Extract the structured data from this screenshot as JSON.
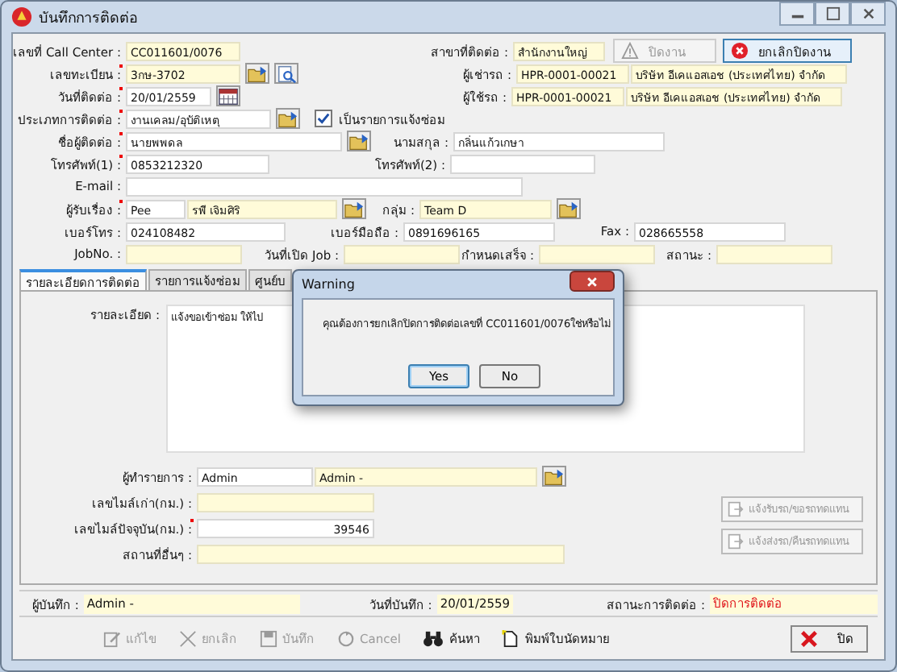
{
  "window": {
    "title": "บันทึกการติดต่อ"
  },
  "header_buttons": [
    {
      "label": "ปิดงาน",
      "kind": "warning",
      "disabled": true
    },
    {
      "label": "ยกเลิกปิดงาน",
      "kind": "cancel",
      "disabled": false
    }
  ],
  "rows": [
    {
      "groups": [
        {
          "kind": "field",
          "label": "เลขที่ Call Center :",
          "required": false,
          "inputs": [
            {
              "value": "CC011601/0076",
              "readonly": true
            }
          ]
        },
        {
          "kind": "field",
          "label": "สาขาที่ติดต่อ :",
          "required": false,
          "inputs": [
            {
              "value": "สำนักงานใหญ่",
              "readonly": true
            }
          ]
        }
      ]
    },
    {
      "groups": [
        {
          "kind": "field",
          "label": "เลขทะเบียน :",
          "required": true,
          "inputs": [
            {
              "value": "3กษ-3702",
              "readonly": true
            }
          ],
          "lookup": true,
          "preview": true
        },
        {
          "kind": "field",
          "label": "ผู้เช่ารถ :",
          "required": false,
          "inputs": [
            {
              "value": "HPR-0001-00021",
              "readonly": true
            },
            {
              "value": "บริษัท อีเคแอสเอช (ประเทศไทย) จำกัด",
              "readonly": true
            }
          ]
        }
      ]
    },
    {
      "groups": [
        {
          "kind": "field",
          "label": "วันที่ติดต่อ :",
          "required": true,
          "inputs": [
            {
              "value": "20/01/2559",
              "readonly": false
            }
          ],
          "calendar": true
        },
        {
          "kind": "field",
          "label": "ผู้ใช้รถ :",
          "required": false,
          "inputs": [
            {
              "value": "HPR-0001-00021",
              "readonly": true
            },
            {
              "value": "บริษัท อีเคแอสเอช (ประเทศไทย) จำกัด",
              "readonly": true
            }
          ]
        }
      ]
    },
    {
      "groups": [
        {
          "kind": "field",
          "label": "ประเภทการติดต่อ :",
          "required": true,
          "inputs": [
            {
              "value": "งานเคลม/อุบัติเหตุ",
              "readonly": false
            }
          ],
          "lookup": true
        },
        {
          "kind": "checkbox",
          "label": "เป็นรายการแจ้งซ่อม",
          "checked": true
        }
      ]
    },
    {
      "groups": [
        {
          "kind": "field",
          "label": "ชื่อผู้ติดต่อ :",
          "required": true,
          "inputs": [
            {
              "value": "นายพพดล",
              "readonly": false
            }
          ],
          "lookup": true
        },
        {
          "kind": "field",
          "label": "นามสกุล :",
          "required": false,
          "inputs": [
            {
              "value": "กลิ่นแก้วเกษา",
              "readonly": false
            }
          ]
        }
      ]
    },
    {
      "groups": [
        {
          "kind": "field",
          "label": "โทรศัพท์(1) :",
          "required": true,
          "inputs": [
            {
              "value": "0853212320",
              "readonly": false
            }
          ]
        },
        {
          "kind": "field",
          "label": "โทรศัพท์(2) :",
          "required": false,
          "inputs": [
            {
              "readonly": false
            }
          ]
        }
      ]
    },
    {
      "groups": [
        {
          "kind": "field",
          "label": "E-mail :",
          "required": false,
          "inputs": [
            {
              "readonly": false
            }
          ]
        }
      ]
    },
    {
      "groups": [
        {
          "kind": "field",
          "label": "ผู้รับเรื่อง :",
          "required": true,
          "inputs": [
            {
              "value": "Pee",
              "readonly": false
            },
            {
              "value": "รพี เจิมศิริ",
              "readonly": true
            }
          ],
          "lookup": true
        },
        {
          "kind": "field",
          "label": "กลุ่ม :",
          "required": false,
          "inputs": [
            {
              "value": "Team D",
              "readonly": true
            }
          ],
          "lookup": true
        }
      ]
    },
    {
      "groups": [
        {
          "kind": "field",
          "label": "เบอร์โทร :",
          "required": false,
          "inputs": [
            {
              "value": "024108482",
              "readonly": false
            }
          ]
        },
        {
          "kind": "field",
          "label": "เบอร์มือถือ :",
          "required": false,
          "inputs": [
            {
              "value": "0891696165",
              "readonly": false
            }
          ]
        },
        {
          "kind": "field",
          "label": "Fax :",
          "required": false,
          "inputs": [
            {
              "value": "028665558",
              "readonly": false
            }
          ]
        }
      ]
    },
    {
      "groups": [
        {
          "kind": "field",
          "label": "JobNo. :",
          "required": false,
          "inputs": [
            {
              "readonly": true
            }
          ]
        },
        {
          "kind": "field",
          "label": "วันที่เปิด Job :",
          "required": false,
          "inputs": [
            {
              "readonly": true
            }
          ]
        },
        {
          "kind": "field",
          "label": "กำหนดเสร็จ :",
          "required": false,
          "inputs": [
            {
              "readonly": true
            }
          ]
        },
        {
          "kind": "field",
          "label": "สถานะ :",
          "required": false,
          "inputs": [
            {
              "readonly": true
            }
          ]
        }
      ]
    }
  ],
  "tabs": [
    {
      "label": "รายละเอียดการติดต่อ",
      "selected": true
    },
    {
      "label": "รายการแจ้งซ่อม",
      "selected": false
    },
    {
      "label": "ศูนย์บ",
      "selected": false
    }
  ],
  "details": {
    "label": "รายละเอียด :",
    "value": "แจ้งขอเข้าซ่อม ให้ไป"
  },
  "panel_rows": [
    {
      "label": "ผู้ทำรายการ :",
      "required": false,
      "inputs": [
        {
          "value": "Admin",
          "readonly": false,
          "kind": "text"
        },
        {
          "value": "Admin -",
          "readonly": true,
          "kind": "text"
        }
      ],
      "lookup": true
    },
    {
      "label": "เลขไมล์เก่า(กม.) :",
      "required": false,
      "inputs": [
        {
          "readonly": true,
          "kind": "number"
        }
      ],
      "lookup": false
    },
    {
      "label": "เลขไมล์ปัจจุบัน(กม.) :",
      "required": true,
      "inputs": [
        {
          "value": "39546",
          "readonly": false,
          "kind": "number"
        }
      ],
      "lookup": false
    },
    {
      "label": "สถานที่อื่นๆ :",
      "required": false,
      "inputs": [
        {
          "readonly": true,
          "kind": "wide"
        }
      ],
      "lookup": false
    }
  ],
  "side_buttons": [
    {
      "label": "แจ้งรับรถ/ขอรถทดแทน",
      "disabled": true
    },
    {
      "label": "แจ้งส่งรถ/คืนรถทดแทน",
      "disabled": true
    }
  ],
  "status_bar": [
    {
      "label": "ผู้บันทึก :",
      "value": "Admin -",
      "alert": false
    },
    {
      "label": "วันที่บันทึก :",
      "value": "20/01/2559",
      "alert": false
    },
    {
      "label": "สถานะการติดต่อ :",
      "value": "ปิดการติดต่อ",
      "alert": true
    }
  ],
  "toolbar": [
    {
      "label": "แก้ไข",
      "kind": "edit",
      "disabled": true
    },
    {
      "label": "ยกเลิก",
      "kind": "delete",
      "disabled": true
    },
    {
      "label": "บันทึก",
      "kind": "save",
      "disabled": true
    },
    {
      "label": "Cancel",
      "kind": "undo",
      "disabled": true
    },
    {
      "label": "ค้นหา",
      "kind": "search",
      "disabled": false
    },
    {
      "label": "พิมพ์ใบนัดหมาย",
      "kind": "print",
      "disabled": false
    }
  ],
  "close_button": {
    "label": "ปิด"
  },
  "dialog": {
    "title": "Warning",
    "message": "คุณต้องการยกเลิกปิดการติดต่อเลขที่ CC011601/0076ใช่หรือไม่",
    "buttons": [
      {
        "label": "Yes",
        "selected": true
      },
      {
        "label": "No",
        "selected": false
      }
    ]
  }
}
